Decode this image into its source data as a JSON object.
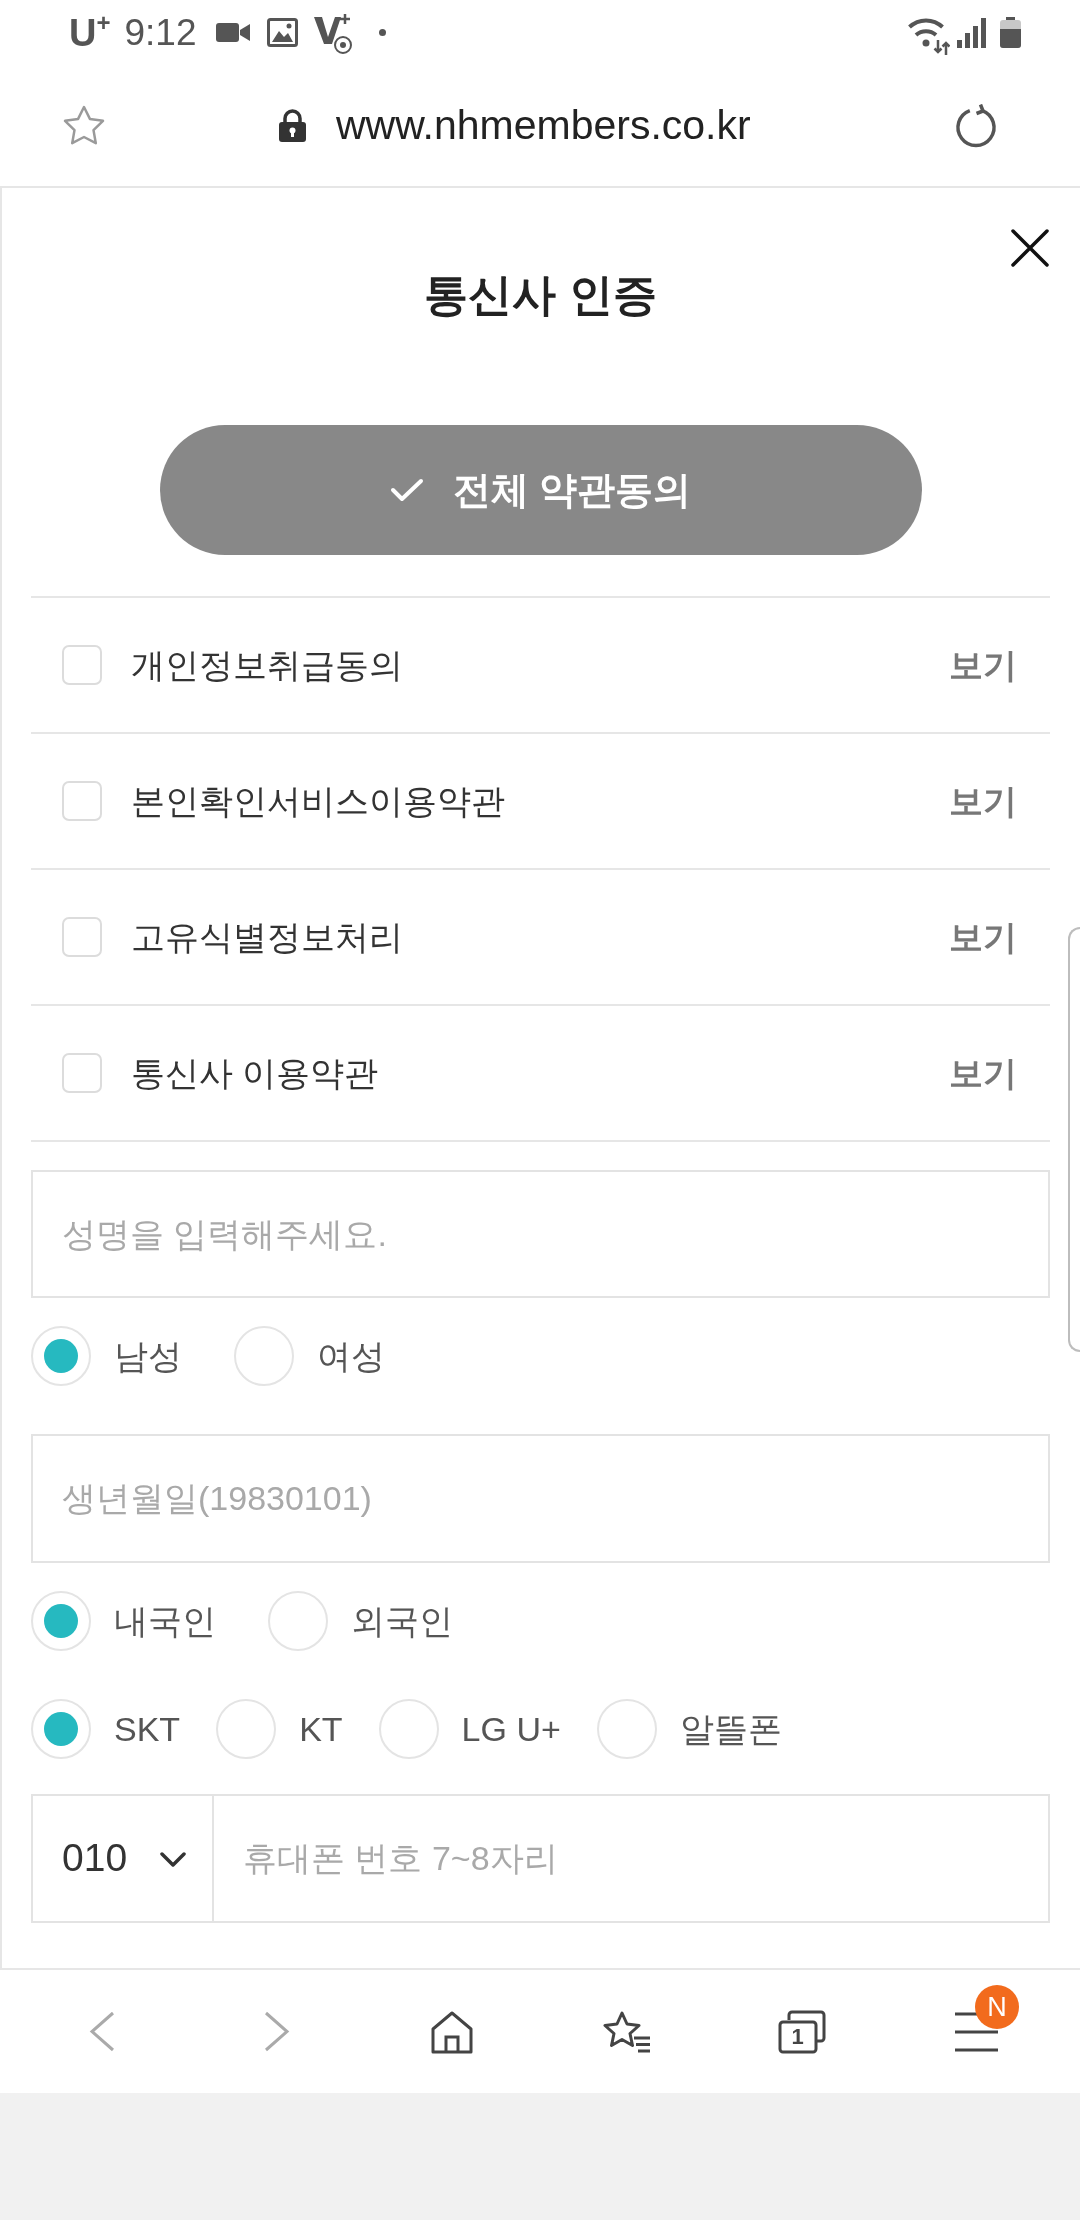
{
  "status_bar": {
    "carrier": "U$^{+}$",
    "time": "9:12"
  },
  "address_bar": {
    "url": "www.nhmembers.co.kr"
  },
  "dialog": {
    "title": "통신사 인증",
    "agree_all": {
      "label": "전체 약관동의",
      "checked": false
    },
    "terms": [
      {
        "label": "개인정보취급동의",
        "checked": false,
        "link": "보기"
      },
      {
        "label": "본인확인서비스이용약관",
        "checked": false,
        "link": "보기"
      },
      {
        "label": "고유식별정보처리",
        "checked": false,
        "link": "보기"
      },
      {
        "label": "통신사 이용약관",
        "checked": false,
        "link": "보기"
      }
    ],
    "name_field": {
      "placeholder": "성명을 입력해주세요."
    },
    "gender": [
      {
        "label": "남성",
        "selected": true
      },
      {
        "label": "여성",
        "selected": false
      }
    ],
    "birth_field": {
      "placeholder": "생년월일(19830101)"
    },
    "nationality": [
      {
        "label": "내국인",
        "selected": true
      },
      {
        "label": "외국인",
        "selected": false
      }
    ],
    "carrier": [
      {
        "label": "SKT",
        "selected": true
      },
      {
        "label": "KT",
        "selected": false
      },
      {
        "label": "LG U+",
        "selected": false
      },
      {
        "label": "알뜰폰",
        "selected": false
      }
    ],
    "phone": {
      "prefix": "010",
      "placeholder": "휴대폰 번호 7~8자리"
    }
  },
  "bottom_bar": {
    "tab_count": "1",
    "menu_badge": "N"
  }
}
